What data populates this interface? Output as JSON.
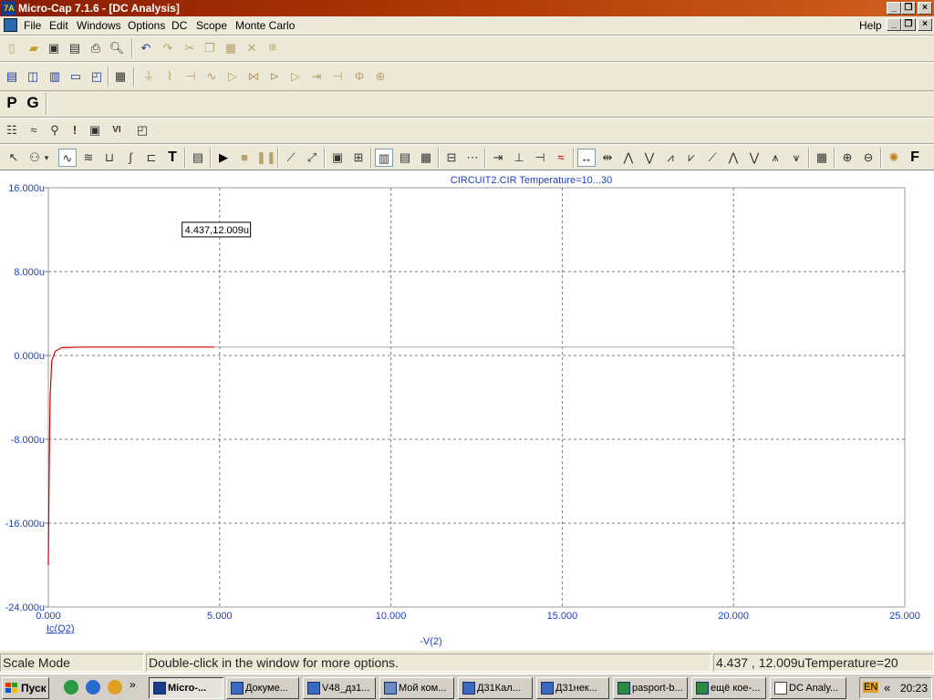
{
  "window": {
    "title": "Micro-Cap 7.1.6 - [DC Analysis]",
    "app_icon": "7A"
  },
  "menu": {
    "items": [
      "File",
      "Edit",
      "Windows",
      "Options",
      "DC",
      "Scope",
      "Monte Carlo"
    ],
    "help": "Help"
  },
  "toolbar_letters": {
    "p": "P",
    "g": "G",
    "f": "F",
    "t": "T"
  },
  "plot": {
    "title": "CIRCUIT2.CIR Temperature=10...30",
    "y_ticks": [
      "16.000u",
      "8.000u",
      "0.000u",
      "-8.000u",
      "-16.000u",
      "-24.000u"
    ],
    "x_ticks": [
      "0.000",
      "5.000",
      "10.000",
      "15.000",
      "20.000",
      "25.000"
    ],
    "x_label": "-V(2)",
    "y_label": "Ic(Q2)",
    "tooltip": "4.437,12.009u",
    "colors": {
      "axis_text": "#1f3fbf",
      "trace": "#d40000",
      "y_label": "#c00000"
    }
  },
  "chart_data": {
    "type": "line",
    "title": "CIRCUIT2.CIR Temperature=10...30",
    "xlabel": "-V(2)",
    "ylabel": "Ic(Q2)",
    "xlim": [
      0,
      25
    ],
    "ylim": [
      -24,
      16
    ],
    "y_unit": "u",
    "grid": true,
    "series": [
      {
        "name": "Ic(Q2)",
        "color": "#d40000",
        "x": [
          0.0,
          0.02,
          0.05,
          0.1,
          0.2,
          0.4,
          1.0,
          4.85
        ],
        "y": [
          -20.0,
          -12.0,
          -4.0,
          -0.5,
          0.4,
          0.75,
          0.8,
          0.8
        ]
      },
      {
        "name": "",
        "color": "#b0b0b0",
        "x": [
          4.85,
          20.0
        ],
        "y": [
          0.8,
          0.8
        ]
      }
    ],
    "marker": {
      "x": 4.437,
      "y": 12.009
    }
  },
  "status": {
    "mode": "Scale Mode",
    "hint": "Double-click in the window for more options.",
    "readout": "4.437 , 12.009uTemperature=20"
  },
  "taskbar": {
    "start": "Пуск",
    "tasks": [
      "Micro-...",
      "Докуме...",
      "V48_дз1...",
      "Мой ком...",
      "Д31Кал...",
      "Д31нек...",
      "pasport-b...",
      "ещё кое-...",
      "DC Analy..."
    ],
    "lang": "EN",
    "chevron": "«",
    "time": "20:23"
  }
}
